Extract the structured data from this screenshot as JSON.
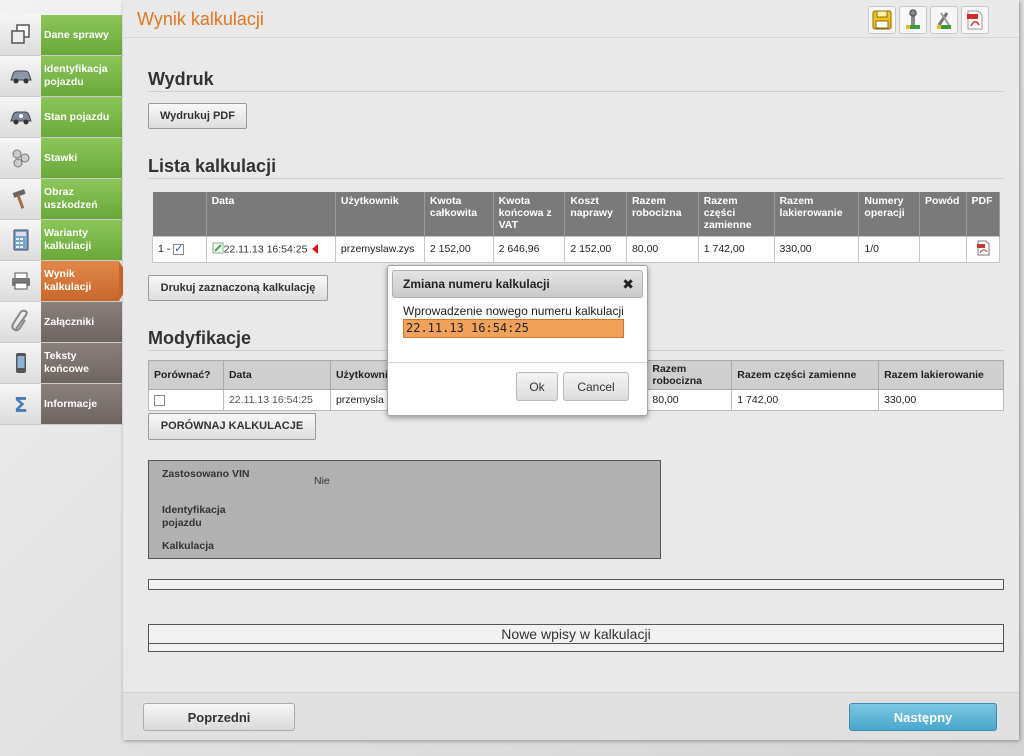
{
  "sidebar": {
    "items": [
      {
        "label": "Dane sprawy",
        "icon": "documents-icon"
      },
      {
        "label": "Identyfikacja pojazdu",
        "icon": "car-icon"
      },
      {
        "label": "Stan pojazdu",
        "icon": "car-state-icon"
      },
      {
        "label": "Stawki",
        "icon": "coins-icon"
      },
      {
        "label": "Obraz uszkodzeń",
        "icon": "hammer-icon"
      },
      {
        "label": "Warianty kalkulacji",
        "icon": "calculator-icon"
      },
      {
        "label": "Wynik kalkulacji",
        "icon": "printer-icon"
      },
      {
        "label": "Załączniki",
        "icon": "paperclip-icon"
      },
      {
        "label": "Teksty końcowe",
        "icon": "phone-icon"
      },
      {
        "label": "Informacje",
        "icon": "sigma-icon"
      }
    ],
    "active_index": 6
  },
  "header": {
    "title": "Wynik kalkulacji"
  },
  "toolbar": {
    "icons": [
      "save-icon",
      "wrench-icon",
      "tools-icon",
      "pdf-icon"
    ]
  },
  "wydruk": {
    "heading": "Wydruk",
    "button": "Wydrukuj PDF"
  },
  "lista": {
    "heading": "Lista kalkulacji",
    "columns": [
      "",
      "Data",
      "Użytkownik",
      "Kwota całkowita",
      "Kwota końcowa z VAT",
      "Koszt naprawy",
      "Razem robocizna",
      "Razem części zamienne",
      "Razem lakierowanie",
      "Numery operacji",
      "Powód",
      "PDF"
    ],
    "row": {
      "num": "1 -",
      "date": "22.11.13 16:54:25",
      "user": "przemyslaw.zys",
      "kwota_calkowita": "2 152,00",
      "kwota_vat": "2 646,96",
      "koszt": "2 152,00",
      "robocizna": "80,00",
      "czesci": "1 742,00",
      "lakier": "330,00",
      "operacje": "1/0",
      "powod": ""
    },
    "print_button": "Drukuj zaznaczoną kalkulację"
  },
  "modyfikacje": {
    "heading": "Modyfikacje",
    "columns": [
      "Porównać?",
      "Data",
      "Użytkownik",
      "Razem robocizna",
      "Razem części zamienne",
      "Razem lakierowanie"
    ],
    "row": {
      "date": "22.11.13 16:54:25",
      "user": "przemysla",
      "robocizna": "80,00",
      "czesci": "1 742,00",
      "lakier": "330,00"
    },
    "compare_button": "PORÓWNAJ KALKULACJE"
  },
  "info": {
    "vin_label": "Zastosowano VIN",
    "vin_value": "Nie",
    "ident_label": "Identyfikacja pojazdu",
    "kalk_label": "Kalkulacja"
  },
  "nowe_wpisy": "Nowe wpisy w kalkulacji",
  "footer": {
    "prev": "Poprzedni",
    "next": "Następny"
  },
  "dialog": {
    "title": "Zmiana numeru kalkulacji",
    "label": "Wprowadzenie nowego numeru kalkulacji",
    "value": "22.11.13 16:54:25",
    "ok": "Ok",
    "cancel": "Cancel"
  },
  "colors": {
    "accent": "#e0781f",
    "green": "#79b648",
    "brown": "#7a706b",
    "next_button": "#5bb4d6"
  }
}
